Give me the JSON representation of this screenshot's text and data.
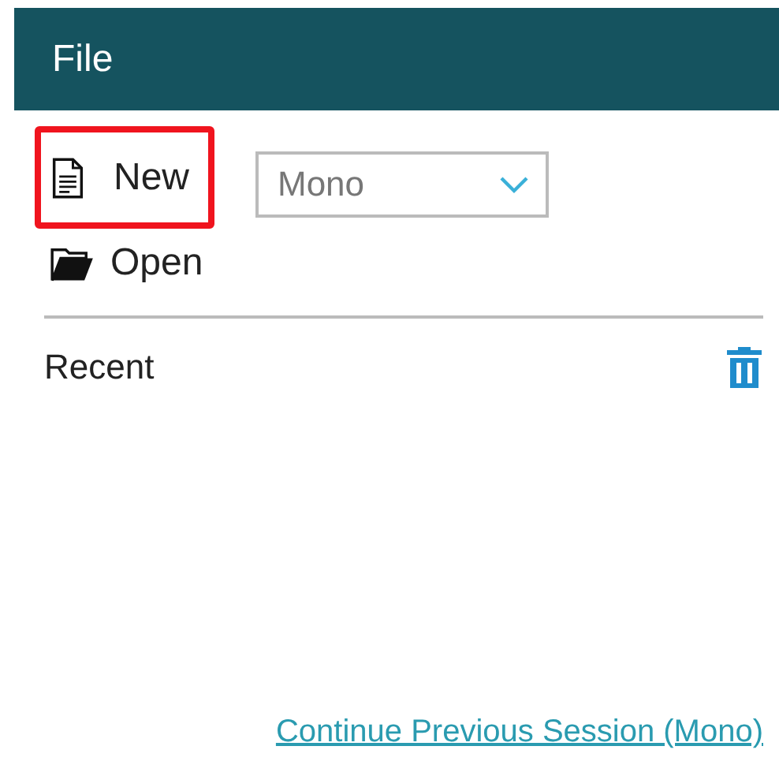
{
  "header": {
    "title": "File"
  },
  "actions": [
    {
      "kind": "new",
      "label": "New",
      "highlighted": true
    },
    {
      "kind": "open",
      "label": "Open",
      "highlighted": false
    }
  ],
  "mode_dropdown": {
    "value": "Mono"
  },
  "recent": {
    "label": "Recent"
  },
  "continue_link": "Continue Previous Session (Mono)"
}
